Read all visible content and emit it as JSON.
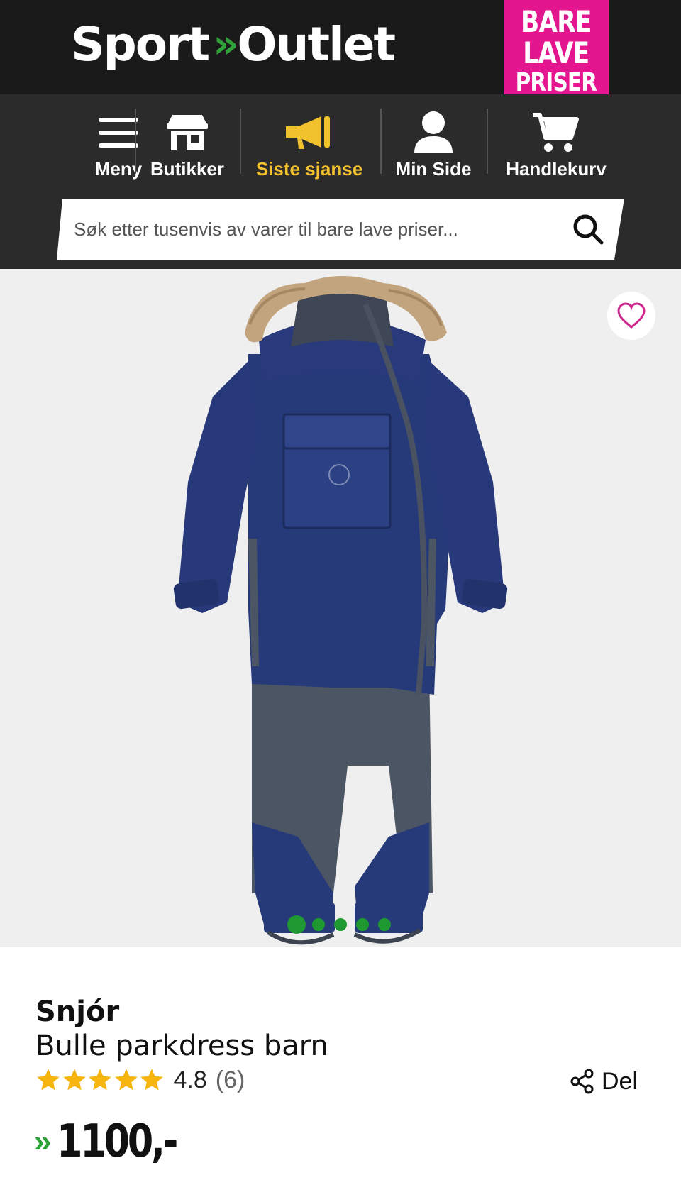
{
  "header": {
    "logo_left": "Sport",
    "logo_mid": "»",
    "logo_right": "Outlet",
    "badge": [
      "BARE",
      "LAVE",
      "PRISER"
    ]
  },
  "nav": {
    "items": [
      {
        "label": "Meny",
        "icon": "menu-icon"
      },
      {
        "label": "Butikker",
        "icon": "store-icon"
      },
      {
        "label": "Siste sjanse",
        "icon": "megaphone-icon"
      },
      {
        "label": "Min Side",
        "icon": "user-icon"
      },
      {
        "label": "Handlekurv",
        "icon": "cart-icon"
      }
    ],
    "active_color": "#f2c12e"
  },
  "search": {
    "placeholder": "Søk etter tusenvis av varer til bare lave priser...",
    "icon": "search-icon"
  },
  "gallery": {
    "image_count": 5,
    "active_index": 0,
    "dot_color": "#1f9a32",
    "favorite_icon": "heart-icon"
  },
  "product": {
    "brand": "Snjór",
    "name": "Bulle parkdress barn",
    "rating": "4.8",
    "rating_count": "(6)",
    "stars": 5,
    "share_label": "Del",
    "price_prefix": "»",
    "price": "1100,-"
  },
  "colors": {
    "header_bg": "#1a1a1a",
    "nav_bg": "#2b2b2b",
    "brand_pink": "#e4168f",
    "brand_green": "#2fa339",
    "star": "#f6b50e"
  }
}
